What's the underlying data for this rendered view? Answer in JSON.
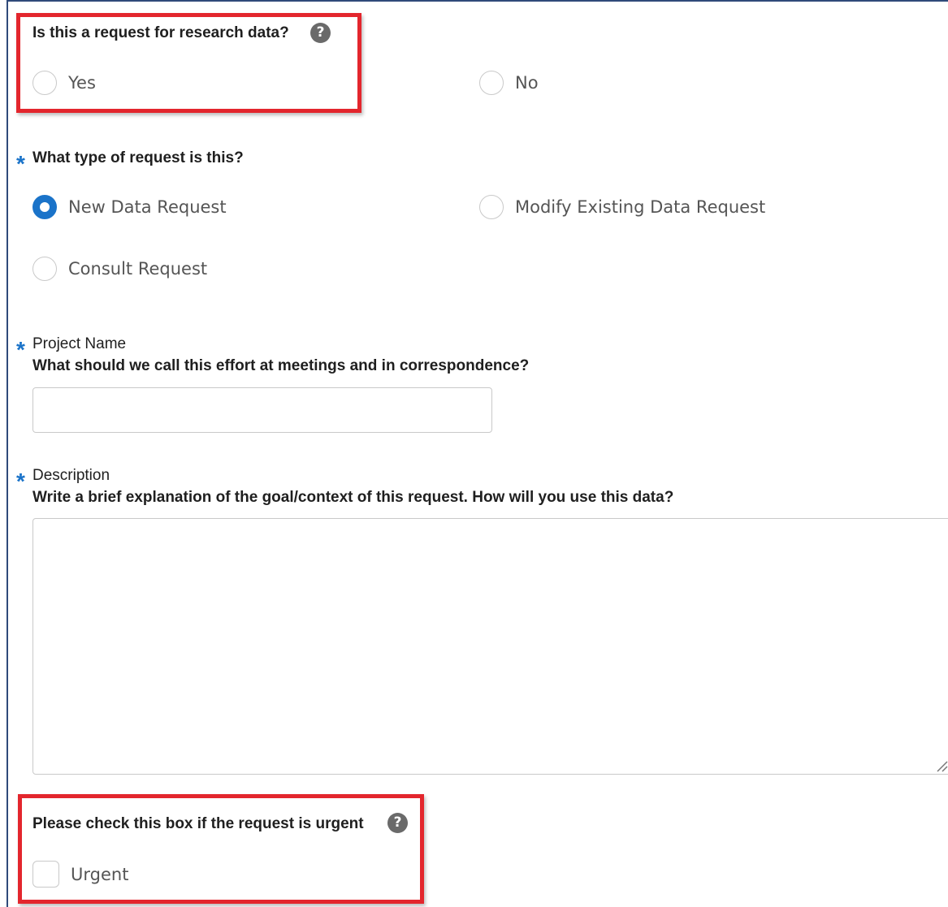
{
  "research_question": {
    "label": "Is this a request for research data?",
    "help_icon": "question-circle-icon",
    "options": [
      {
        "label": "Yes",
        "selected": false
      },
      {
        "label": "No",
        "selected": false
      }
    ]
  },
  "request_type": {
    "required_marker": "*",
    "label": "What type of request is this?",
    "options": [
      {
        "label": "New Data Request",
        "selected": true
      },
      {
        "label": "Modify Existing Data Request",
        "selected": false
      },
      {
        "label": "Consult Request",
        "selected": false
      }
    ]
  },
  "project_name": {
    "required_marker": "*",
    "label": "Project Name",
    "sublabel": "What should we call this effort at meetings and in correspondence?",
    "value": "",
    "placeholder": ""
  },
  "description": {
    "required_marker": "*",
    "label": "Description",
    "sublabel": "Write a brief explanation of the goal/context of this request. How will you use this data?",
    "value": "",
    "placeholder": ""
  },
  "urgent": {
    "label": "Please check this box if the request is urgent",
    "help_icon": "question-circle-icon",
    "checkbox_label": "Urgent",
    "checked": false
  },
  "colors": {
    "accent": "#1a73c9",
    "highlight": "#e3262d",
    "frame_border": "#2f4a7a"
  }
}
